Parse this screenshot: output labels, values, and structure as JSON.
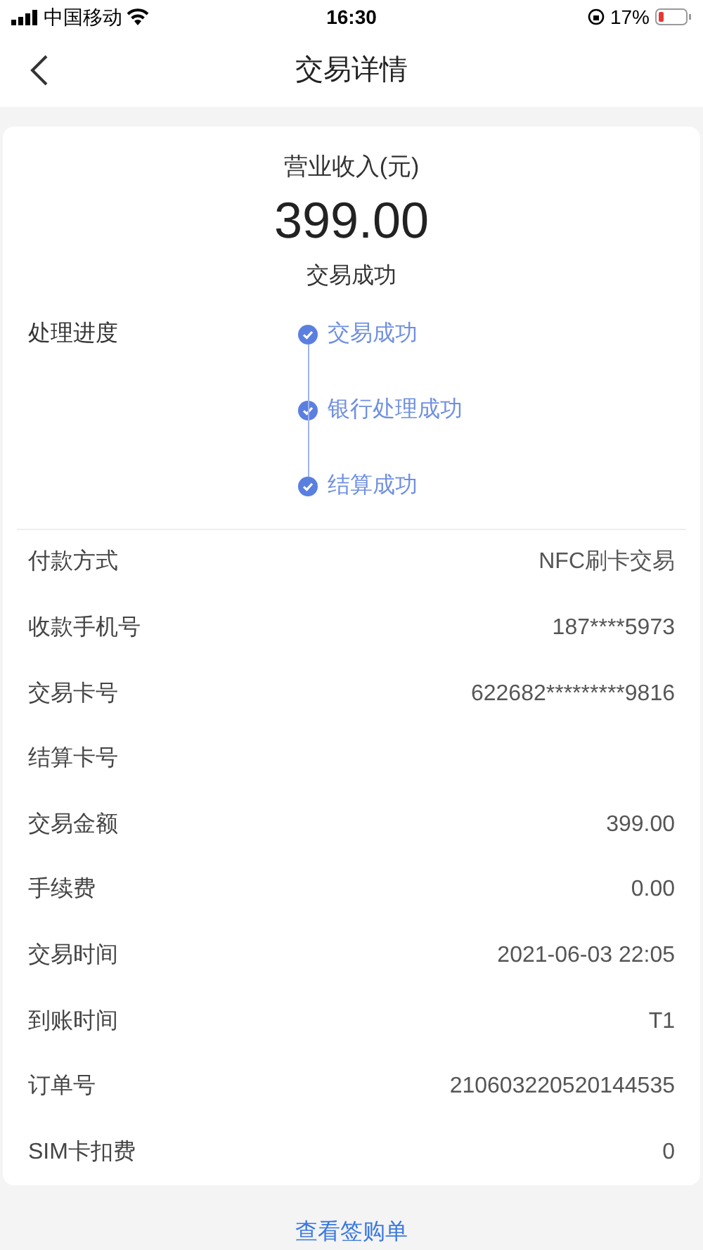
{
  "status_bar": {
    "carrier": "中国移动",
    "time": "16:30",
    "battery": "17%"
  },
  "nav": {
    "title": "交易详情"
  },
  "summary": {
    "label": "营业收入(元)",
    "amount": "399.00",
    "status": "交易成功"
  },
  "progress": {
    "label": "处理进度",
    "steps": [
      {
        "label": "交易成功"
      },
      {
        "label": "银行处理成功"
      },
      {
        "label": "结算成功"
      }
    ]
  },
  "details": [
    {
      "label": "付款方式",
      "value": "NFC刷卡交易"
    },
    {
      "label": "收款手机号",
      "value": "187****5973"
    },
    {
      "label": "交易卡号",
      "value": "622682*********9816"
    },
    {
      "label": "结算卡号"
    },
    {
      "label": "交易金额",
      "value": "399.00"
    },
    {
      "label": "手续费",
      "value": "0.00"
    },
    {
      "label": "交易时间",
      "value": "2021-06-03 22:05"
    },
    {
      "label": "到账时间",
      "value": "T1"
    },
    {
      "label": "订单号",
      "value": "210603220520144535"
    },
    {
      "label": "SIM卡扣费",
      "value": "0"
    }
  ],
  "footer_link": "查看签购单"
}
